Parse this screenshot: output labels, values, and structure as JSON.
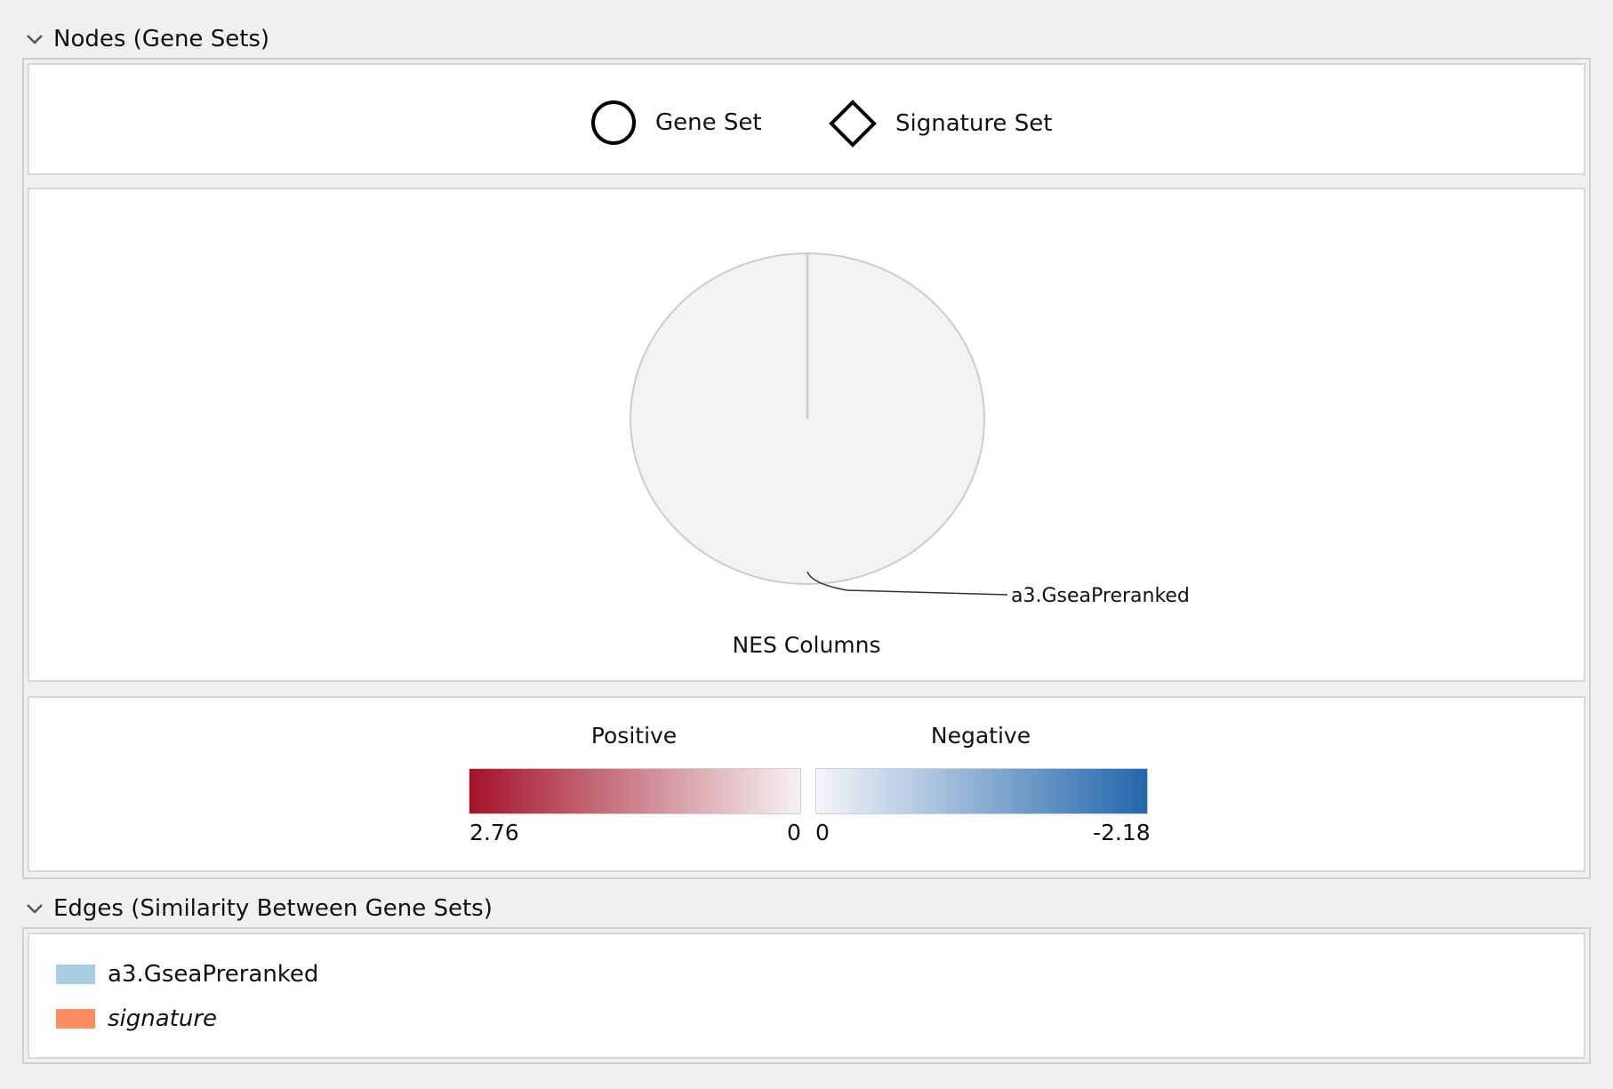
{
  "nodes_section": {
    "title": "Nodes (Gene Sets)",
    "shapes": [
      {
        "label": "Gene Set",
        "icon": "circle-icon"
      },
      {
        "label": "Signature Set",
        "icon": "diamond-icon"
      }
    ],
    "pie": {
      "slice_label": "a3.GseaPreranked",
      "title": "NES Columns",
      "fill_color": "#f3f3f3",
      "stroke_color": "#cccccc"
    },
    "color_scale": {
      "positive": {
        "label": "Positive",
        "max": "2.76",
        "min": "0",
        "from_color": "#a5132a",
        "to_color": "#f6f2f3"
      },
      "negative": {
        "label": "Negative",
        "min": "0",
        "max": "-2.18",
        "from_color": "#f4f6f9",
        "to_color": "#2366ad"
      }
    }
  },
  "edges_section": {
    "title": "Edges (Similarity Between Gene Sets)",
    "items": [
      {
        "label": "a3.GseaPreranked",
        "color": "#a6cde2",
        "italic": false
      },
      {
        "label": "signature",
        "color": "#fc8d62",
        "italic": true
      }
    ]
  }
}
